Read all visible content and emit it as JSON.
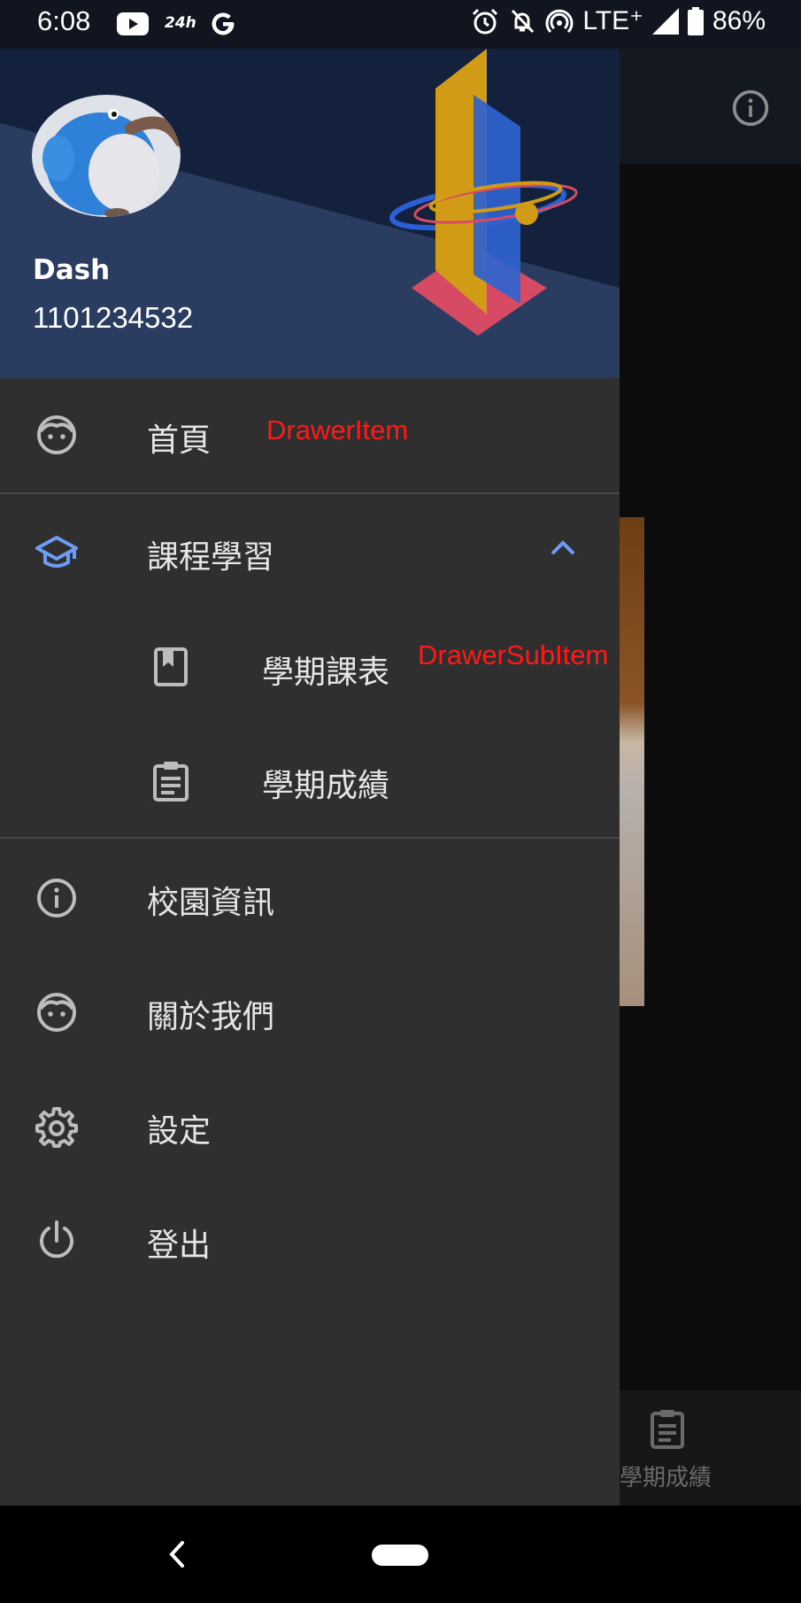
{
  "status_bar": {
    "time": "6:08",
    "carrier_icon_label": "24h",
    "network": "LTE⁺",
    "battery": "86%",
    "icons": [
      "youtube-icon",
      "24h-icon",
      "google-icon",
      "alarm-icon",
      "notifications-off-icon",
      "hotspot-icon",
      "signal-icon",
      "battery-icon"
    ]
  },
  "drawer": {
    "header": {
      "user_name": "Dash",
      "user_id": "1101234532"
    },
    "items": [
      {
        "name": "home",
        "label": "首頁",
        "icon": "face-icon"
      },
      {
        "name": "courses",
        "label": "課程學習",
        "icon": "school-icon",
        "expanded": true,
        "children": [
          {
            "name": "semester-schedule",
            "label": "學期課表",
            "icon": "book-icon"
          },
          {
            "name": "semester-grades",
            "label": "學期成績",
            "icon": "clipboard-icon"
          }
        ]
      },
      {
        "name": "campus-info",
        "label": "校園資訊",
        "icon": "info-icon"
      },
      {
        "name": "about-us",
        "label": "關於我們",
        "icon": "face-icon"
      },
      {
        "name": "settings",
        "label": "設定",
        "icon": "gear-icon"
      },
      {
        "name": "logout",
        "label": "登出",
        "icon": "power-icon"
      }
    ],
    "annotations": {
      "item": "DrawerItem",
      "sub_item": "DrawerSubItem"
    }
  },
  "background_app": {
    "bottom_tab_label": "學期成績"
  },
  "colors": {
    "drawer_bg": "#2f2f2f",
    "header_navy": "#14213d",
    "header_blue": "#2b3c61",
    "accent_blue": "#6e9cf5",
    "annotation_red": "#ff1a1a"
  }
}
